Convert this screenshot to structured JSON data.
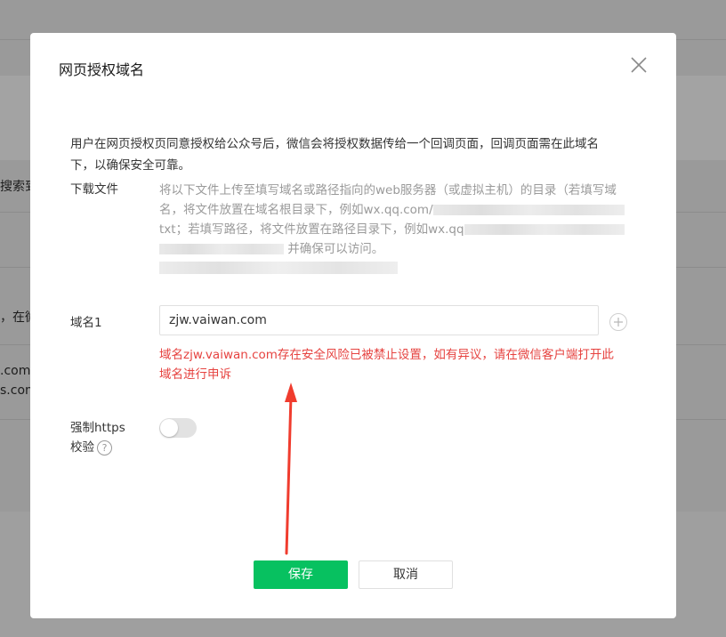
{
  "background": {
    "snippets": [
      "搜索到",
      "，在微",
      ".com",
      "s.com"
    ]
  },
  "dialog": {
    "title": "网页授权域名",
    "intro": "用户在网页授权页同意授权给公众号后，微信会将授权数据传给一个回调页面，回调页面需在此域名下，以确保安全可靠。",
    "download_label": "下载文件",
    "download_desc": {
      "line1": "将以下文件上传至填写域名或路径指向的web服务器（或虚拟主机）的目录（若填写域",
      "line2": "名，将文件放置在域名根目录下，例如wx.qq.com/",
      "line3": "txt；若填写路径，将文件放置在路径目录下，例如wx.qq",
      "line4": "并确保可以访问。"
    },
    "domain_label": "域名1",
    "domain_value": "zjw.vaiwan.com",
    "error_message": "域名zjw.vaiwan.com存在安全风险已被禁止设置，如有异议，请在微信客户端打开此域名进行申诉",
    "https_label_line1": "强制https",
    "https_label_line2": "校验",
    "help_icon_glyph": "?",
    "https_enabled": false,
    "save_label": "保存",
    "cancel_label": "取消"
  },
  "colors": {
    "primary": "#07c160",
    "error": "#e64340",
    "annotation_arrow": "#f03c2e"
  }
}
